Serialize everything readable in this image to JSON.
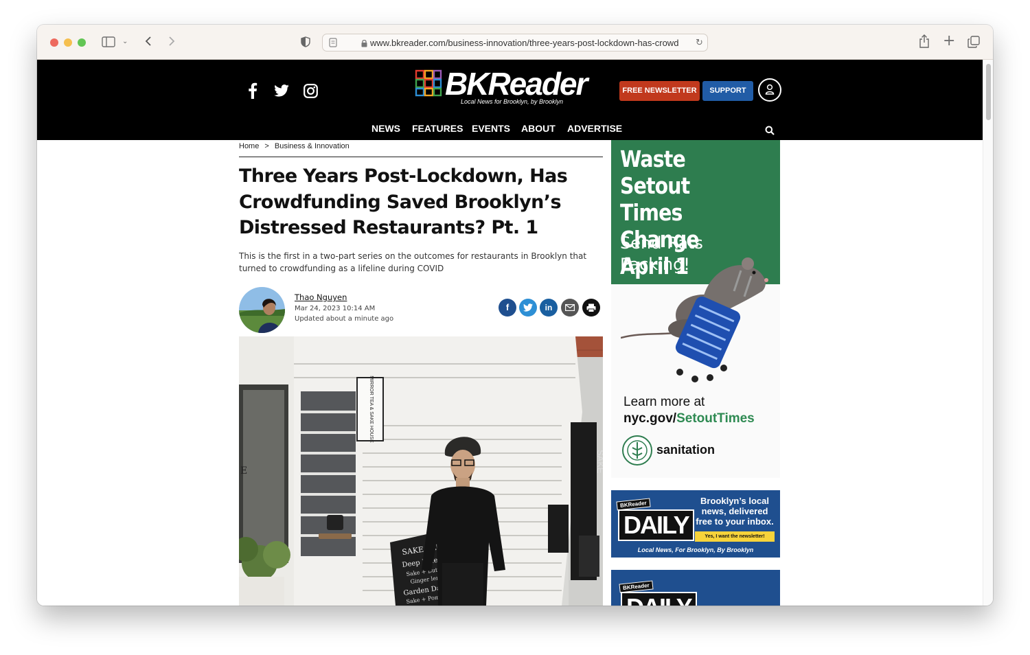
{
  "browser": {
    "url": "www.bkreader.com/business-innovation/three-years-post-lockdown-has-crowd"
  },
  "site": {
    "logo_text": "BKReader",
    "tagline": "Local News for Brooklyn, by Brooklyn",
    "newsletter_label": "FREE NEWSLETTER",
    "support_label": "SUPPORT",
    "nav": [
      "NEWS",
      "FEATURES",
      "EVENTS",
      "ABOUT",
      "ADVERTISE"
    ],
    "colors": {
      "newsletter": "#c1391d",
      "support": "#215ca6",
      "header_bg": "#000000"
    }
  },
  "breadcrumb": {
    "home": "Home",
    "sep": ">",
    "section": "Business & Innovation"
  },
  "article": {
    "headline": "Three Years Post-Lockdown, Has Crowdfunding Saved Brooklyn’s Distressed Restaurants? Pt. 1",
    "dek": "This is the first in a two-part series on the outcomes for restaurants in Brooklyn that turned to crowdfunding as a lifeline during COVID",
    "author": "Thao Nguyen",
    "date": "Mar 24, 2023 10:14 AM",
    "updated": "Updated about a minute ago",
    "share_icons": [
      "facebook-icon",
      "twitter-icon",
      "linkedin-icon",
      "email-icon",
      "print-icon"
    ]
  },
  "hero": {
    "sign": "MIRROR TEA & SAKE HOUSE",
    "board_1": "SAKE SLUSH",
    "board_2": "Deep Blue Dr",
    "board_3": "Sake + Butterfly",
    "board_4": "Ginger lemon",
    "board_5": "Garden Dark Re",
    "board_6": "Sake + Pomegranate",
    "vertical_sign": "SAKE",
    "edge_letter": "E"
  },
  "ads": {
    "sanitation": {
      "headline_lines": [
        "Waste Setout",
        "Times Change",
        "April 1"
      ],
      "sub_lines": [
        "Send Rats",
        "Packing!"
      ],
      "learn": "Learn more at",
      "url_prefix": "nyc.gov/",
      "url_highlight": "SetoutTimes",
      "agency": "sanitation"
    },
    "daily": {
      "tag": "BKReader",
      "title": "DAILY",
      "pitch": "Brooklyn’s local news, delivered free to your inbox.",
      "cta": "Yes, I want the newsletter!",
      "footer": "Local News, For Brooklyn, By Brooklyn"
    },
    "daily2": {
      "tag": "BKReader",
      "title": "DAILY"
    }
  }
}
